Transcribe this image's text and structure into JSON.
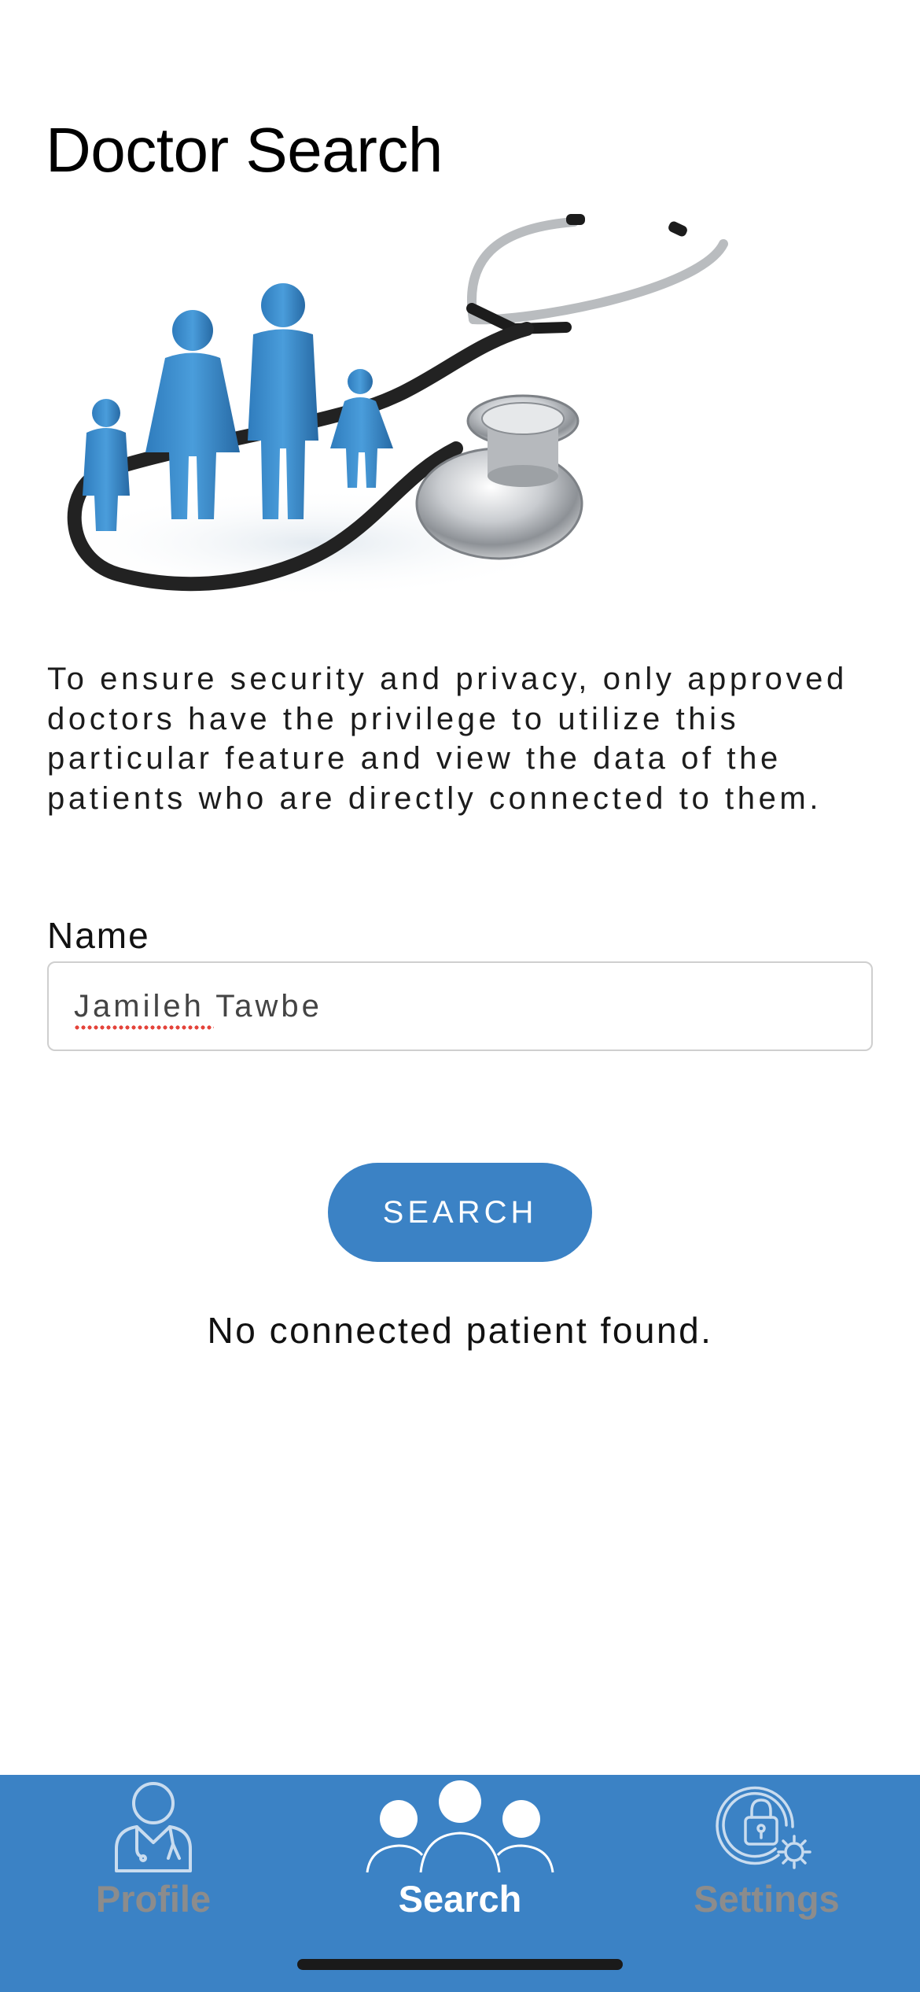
{
  "header": {
    "title": "Doctor Search"
  },
  "main": {
    "description": "To ensure security and privacy, only approved doctors have the privilege to utilize this particular feature and view the data of the patients who are directly connected to them.",
    "name_label": "Name",
    "name_value": "Jamileh Tawbe",
    "search_button_label": "SEARCH",
    "status_message": "No connected patient found."
  },
  "tabbar": {
    "tabs": [
      {
        "label": "Profile",
        "icon": "doctor-icon",
        "active": false
      },
      {
        "label": "Search",
        "icon": "people-group-icon",
        "active": true
      },
      {
        "label": "Settings",
        "icon": "lock-gear-icon",
        "active": false
      }
    ]
  },
  "colors": {
    "accent": "#3b82c5",
    "inactive_tab_label": "#8c8c8c",
    "active_tab_label": "#ffffff",
    "illustration_people": "#3d8fcf"
  }
}
